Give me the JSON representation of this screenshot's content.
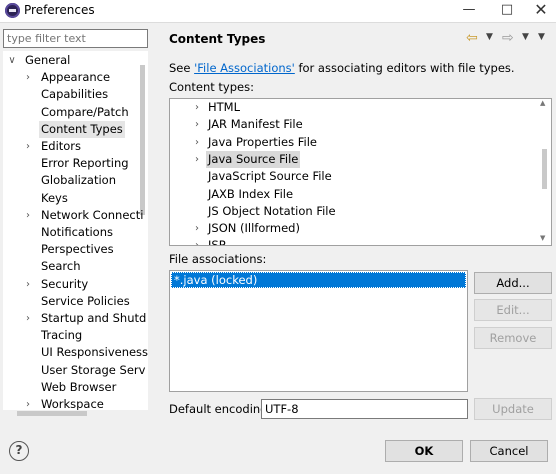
{
  "window": {
    "title": "Preferences",
    "minimize_glyph": "—",
    "maximize_glyph": "□",
    "close_glyph": "✕"
  },
  "sidebar": {
    "filter_placeholder": "type filter text",
    "items": [
      {
        "label": "General",
        "level": 0,
        "twisty": "expanded"
      },
      {
        "label": "Appearance",
        "level": 1,
        "twisty": "collapsed"
      },
      {
        "label": "Capabilities",
        "level": 1,
        "twisty": "none"
      },
      {
        "label": "Compare/Patch",
        "level": 1,
        "twisty": "none"
      },
      {
        "label": "Content Types",
        "level": 1,
        "twisty": "none",
        "selected": true
      },
      {
        "label": "Editors",
        "level": 1,
        "twisty": "collapsed"
      },
      {
        "label": "Error Reporting",
        "level": 1,
        "twisty": "none"
      },
      {
        "label": "Globalization",
        "level": 1,
        "twisty": "none"
      },
      {
        "label": "Keys",
        "level": 1,
        "twisty": "none"
      },
      {
        "label": "Network Connecti",
        "level": 1,
        "twisty": "collapsed"
      },
      {
        "label": "Notifications",
        "level": 1,
        "twisty": "none"
      },
      {
        "label": "Perspectives",
        "level": 1,
        "twisty": "none"
      },
      {
        "label": "Search",
        "level": 1,
        "twisty": "none"
      },
      {
        "label": "Security",
        "level": 1,
        "twisty": "collapsed"
      },
      {
        "label": "Service Policies",
        "level": 1,
        "twisty": "none"
      },
      {
        "label": "Startup and Shutd",
        "level": 1,
        "twisty": "collapsed"
      },
      {
        "label": "Tracing",
        "level": 1,
        "twisty": "none"
      },
      {
        "label": "UI Responsiveness",
        "level": 1,
        "twisty": "none"
      },
      {
        "label": "User Storage Serv",
        "level": 1,
        "twisty": "none"
      },
      {
        "label": "Web Browser",
        "level": 1,
        "twisty": "none"
      },
      {
        "label": "Workspace",
        "level": 1,
        "twisty": "collapsed"
      }
    ]
  },
  "page": {
    "title": "Content Types",
    "info_prefix": "See ",
    "info_link": "'File Associations'",
    "info_suffix": " for associating editors with file types.",
    "content_types_label": "Content types:",
    "content_types": [
      {
        "label": "HTML",
        "twisty": "collapsed"
      },
      {
        "label": "JAR Manifest File",
        "twisty": "collapsed"
      },
      {
        "label": "Java Properties File",
        "twisty": "collapsed"
      },
      {
        "label": "Java Source File",
        "twisty": "collapsed",
        "selected": true
      },
      {
        "label": "JavaScript Source File",
        "twisty": "none"
      },
      {
        "label": "JAXB Index File",
        "twisty": "none"
      },
      {
        "label": "JS Object Notation File",
        "twisty": "none"
      },
      {
        "label": "JSON (Illformed)",
        "twisty": "collapsed"
      },
      {
        "label": "JSP",
        "twisty": "collapsed"
      }
    ],
    "file_associations_label": "File associations:",
    "file_associations": [
      "*.java (locked)"
    ],
    "add_button": "Add...",
    "edit_button": "Edit...",
    "remove_button": "Remove",
    "default_encoding_label": "Default encoding:",
    "default_encoding_value": "UTF-8",
    "update_button": "Update"
  },
  "footer": {
    "help_glyph": "?",
    "ok_button": "OK",
    "cancel_button": "Cancel"
  },
  "colors": {
    "selection": "#0078d7",
    "link": "#0066cc",
    "back_arrow": "#c99a2c"
  }
}
